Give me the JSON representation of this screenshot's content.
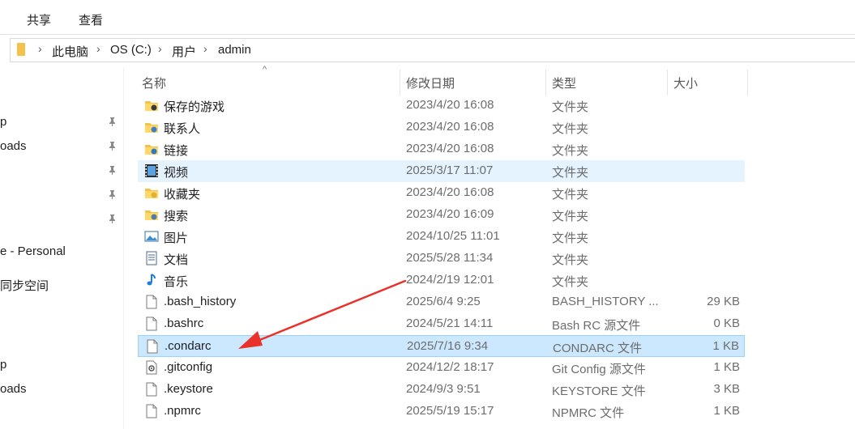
{
  "ribbon": {
    "tabs": [
      "共享",
      "查看"
    ]
  },
  "address": {
    "path": [
      "此电脑",
      "OS (C:)",
      "用户",
      "admin"
    ]
  },
  "nav": {
    "items": [
      {
        "label": "p",
        "pinned": true
      },
      {
        "label": "oads",
        "pinned": true
      },
      {
        "label": "",
        "pinned": true
      },
      {
        "label": "",
        "pinned": true
      },
      {
        "label": "",
        "pinned": true
      },
      {
        "label": "e - Personal",
        "pinned": false
      },
      {
        "label": "同步空间",
        "pinned": false
      },
      {
        "label": "p",
        "pinned": false
      },
      {
        "label": "oads",
        "pinned": false
      }
    ]
  },
  "columns": {
    "name": "名称",
    "date": "修改日期",
    "type": "类型",
    "size": "大小",
    "sort_indicator": "^"
  },
  "files": [
    {
      "name": "保存的游戏",
      "date": "2023/4/20 16:08",
      "type": "文件夹",
      "size": "",
      "icon": "saved-games-folder-icon",
      "state": ""
    },
    {
      "name": "联系人",
      "date": "2023/4/20 16:08",
      "type": "文件夹",
      "size": "",
      "icon": "contacts-folder-icon",
      "state": ""
    },
    {
      "name": "链接",
      "date": "2023/4/20 16:08",
      "type": "文件夹",
      "size": "",
      "icon": "links-folder-icon",
      "state": ""
    },
    {
      "name": "视频",
      "date": "2025/3/17 11:07",
      "type": "文件夹",
      "size": "",
      "icon": "videos-folder-icon",
      "state": "hover"
    },
    {
      "name": "收藏夹",
      "date": "2023/4/20 16:08",
      "type": "文件夹",
      "size": "",
      "icon": "favorites-folder-icon",
      "state": ""
    },
    {
      "name": "搜索",
      "date": "2023/4/20 16:09",
      "type": "文件夹",
      "size": "",
      "icon": "searches-folder-icon",
      "state": ""
    },
    {
      "name": "图片",
      "date": "2024/10/25 11:01",
      "type": "文件夹",
      "size": "",
      "icon": "pictures-folder-icon",
      "state": ""
    },
    {
      "name": "文档",
      "date": "2025/5/28 11:34",
      "type": "文件夹",
      "size": "",
      "icon": "documents-folder-icon",
      "state": ""
    },
    {
      "name": "音乐",
      "date": "2024/2/19 12:01",
      "type": "文件夹",
      "size": "",
      "icon": "music-folder-icon",
      "state": ""
    },
    {
      "name": ".bash_history",
      "date": "2025/6/4 9:25",
      "type": "BASH_HISTORY ...",
      "size": "29 KB",
      "icon": "file-icon",
      "state": ""
    },
    {
      "name": ".bashrc",
      "date": "2024/5/21 14:11",
      "type": "Bash RC 源文件",
      "size": "0 KB",
      "icon": "file-icon",
      "state": ""
    },
    {
      "name": ".condarc",
      "date": "2025/7/16 9:34",
      "type": "CONDARC 文件",
      "size": "1 KB",
      "icon": "file-icon",
      "state": "selected"
    },
    {
      "name": ".gitconfig",
      "date": "2024/12/2 18:17",
      "type": "Git Config 源文件",
      "size": "1 KB",
      "icon": "config-file-icon",
      "state": ""
    },
    {
      "name": ".keystore",
      "date": "2024/9/3 9:51",
      "type": "KEYSTORE 文件",
      "size": "3 KB",
      "icon": "file-icon",
      "state": ""
    },
    {
      "name": ".npmrc",
      "date": "2025/5/19 15:17",
      "type": "NPMRC 文件",
      "size": "1 KB",
      "icon": "file-icon",
      "state": ""
    }
  ],
  "annotation": {
    "color": "#e8322b",
    "points_to": ".condarc"
  },
  "colors": {
    "selected_bg": "#cce8ff",
    "selected_border": "#99d1ff",
    "hover_bg": "#e5f3ff",
    "folder": "#f4c24a"
  }
}
